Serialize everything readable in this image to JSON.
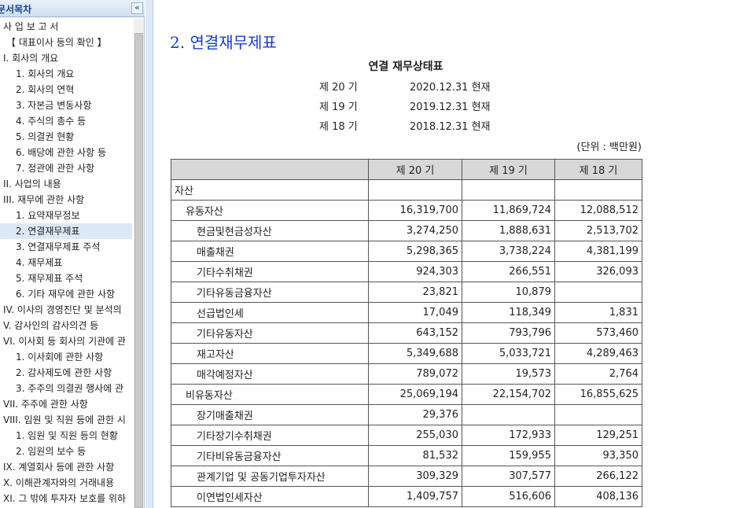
{
  "sidebar": {
    "title": "문서목차",
    "collapse_glyph": "«",
    "items": [
      {
        "label": "사 업 보 고 서",
        "level": 0,
        "selected": false
      },
      {
        "label": "【 대표이사 등의 확인 】",
        "level": 2,
        "selected": false
      },
      {
        "label": "I. 회사의 개요",
        "level": 0,
        "selected": false
      },
      {
        "label": "1. 회사의 개요",
        "level": 1,
        "selected": false
      },
      {
        "label": "2. 회사의 연혁",
        "level": 1,
        "selected": false
      },
      {
        "label": "3. 자본금 변동사항",
        "level": 1,
        "selected": false
      },
      {
        "label": "4. 주식의 총수 등",
        "level": 1,
        "selected": false
      },
      {
        "label": "5. 의결권 현황",
        "level": 1,
        "selected": false
      },
      {
        "label": "6. 배당에 관한 사항 등",
        "level": 1,
        "selected": false
      },
      {
        "label": "7. 정관에 관한 사항",
        "level": 1,
        "selected": false
      },
      {
        "label": "II. 사업의 내용",
        "level": 0,
        "selected": false
      },
      {
        "label": "III. 재무에 관한 사항",
        "level": 0,
        "selected": false
      },
      {
        "label": "1. 요약재무정보",
        "level": 1,
        "selected": false
      },
      {
        "label": "2. 연결재무제표",
        "level": 1,
        "selected": true
      },
      {
        "label": "3. 연결재무제표 주석",
        "level": 1,
        "selected": false
      },
      {
        "label": "4. 재무제표",
        "level": 1,
        "selected": false
      },
      {
        "label": "5. 재무제표 주석",
        "level": 1,
        "selected": false
      },
      {
        "label": "6. 기타 재무에 관한 사항",
        "level": 1,
        "selected": false
      },
      {
        "label": "IV. 이사의 경영진단 및 분석의",
        "level": 0,
        "selected": false
      },
      {
        "label": "V. 감사인의 감사의견 등",
        "level": 0,
        "selected": false
      },
      {
        "label": "VI. 이사회 등 회사의 기관에 관",
        "level": 0,
        "selected": false
      },
      {
        "label": "1. 이사회에 관한 사항",
        "level": 1,
        "selected": false
      },
      {
        "label": "2. 감사제도에 관한 사항",
        "level": 1,
        "selected": false
      },
      {
        "label": "3. 주주의 의결권 행사에 관",
        "level": 1,
        "selected": false
      },
      {
        "label": "VII. 주주에 관한 사항",
        "level": 0,
        "selected": false
      },
      {
        "label": "VIII. 임원 및 직원 등에 관한 시",
        "level": 0,
        "selected": false
      },
      {
        "label": "1. 임원 및 직원 등의 현황",
        "level": 1,
        "selected": false
      },
      {
        "label": "2. 임원의 보수 등",
        "level": 1,
        "selected": false
      },
      {
        "label": "IX. 계열회사 등에 관한 사항",
        "level": 0,
        "selected": false
      },
      {
        "label": "X. 이해관계자와의 거래내용",
        "level": 0,
        "selected": false
      },
      {
        "label": "XI. 그 밖에 투자자 보호를 위하",
        "level": 0,
        "selected": false
      }
    ]
  },
  "content": {
    "section_title": "2. 연결재무제표",
    "report_title": "연결 재무상태표",
    "periods": [
      {
        "period": "제 20 기",
        "date": "2020.12.31 현재"
      },
      {
        "period": "제 19 기",
        "date": "2019.12.31 현재"
      },
      {
        "period": "제 18 기",
        "date": "2018.12.31 현재"
      }
    ],
    "unit": "(단위 : 백만원)",
    "table": {
      "headers": [
        "",
        "제 20 기",
        "제 19 기",
        "제 18 기"
      ],
      "rows": [
        {
          "label": "자산",
          "level": 0,
          "values": [
            "",
            "",
            ""
          ]
        },
        {
          "label": "유동자산",
          "level": 1,
          "values": [
            "16,319,700",
            "11,869,724",
            "12,088,512"
          ]
        },
        {
          "label": "현금및현금성자산",
          "level": 2,
          "values": [
            "3,274,250",
            "1,888,631",
            "2,513,702"
          ]
        },
        {
          "label": "매출채권",
          "level": 2,
          "values": [
            "5,298,365",
            "3,738,224",
            "4,381,199"
          ]
        },
        {
          "label": "기타수취채권",
          "level": 2,
          "values": [
            "924,303",
            "266,551",
            "326,093"
          ]
        },
        {
          "label": "기타유동금융자산",
          "level": 2,
          "values": [
            "23,821",
            "10,879",
            ""
          ]
        },
        {
          "label": "선급법인세",
          "level": 2,
          "values": [
            "17,049",
            "118,349",
            "1,831"
          ]
        },
        {
          "label": "기타유동자산",
          "level": 2,
          "values": [
            "643,152",
            "793,796",
            "573,460"
          ]
        },
        {
          "label": "재고자산",
          "level": 2,
          "values": [
            "5,349,688",
            "5,033,721",
            "4,289,463"
          ]
        },
        {
          "label": "매각예정자산",
          "level": 2,
          "values": [
            "789,072",
            "19,573",
            "2,764"
          ]
        },
        {
          "label": "비유동자산",
          "level": 1,
          "values": [
            "25,069,194",
            "22,154,702",
            "16,855,625"
          ]
        },
        {
          "label": "장기매출채권",
          "level": 2,
          "values": [
            "29,376",
            "",
            ""
          ]
        },
        {
          "label": "기타장기수취채권",
          "level": 2,
          "values": [
            "255,030",
            "172,933",
            "129,251"
          ]
        },
        {
          "label": "기타비유동금융자산",
          "level": 2,
          "values": [
            "81,532",
            "159,955",
            "93,350"
          ]
        },
        {
          "label": "관계기업 및 공동기업투자자산",
          "level": 2,
          "values": [
            "309,329",
            "307,577",
            "266,122"
          ]
        },
        {
          "label": "이연법인세자산",
          "level": 2,
          "values": [
            "1,409,757",
            "516,606",
            "408,136"
          ]
        }
      ]
    }
  }
}
